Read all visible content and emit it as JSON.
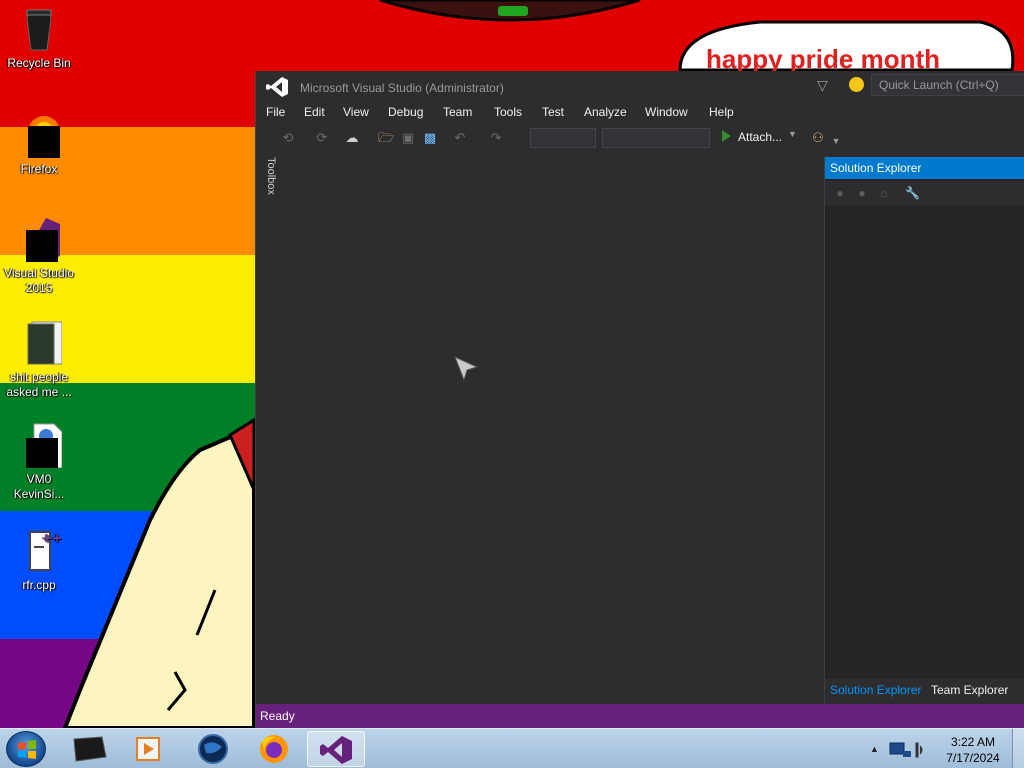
{
  "desktop": {
    "banner_text": "happy pride month",
    "icons": [
      {
        "label": "Recycle Bin"
      },
      {
        "label": "Firefox"
      },
      {
        "label": "Visual Studio 2015"
      },
      {
        "label": "shit people asked me ..."
      },
      {
        "label": "VM0 KevinSi..."
      },
      {
        "label": "rfr.cpp"
      }
    ]
  },
  "vs": {
    "title": "Microsoft Visual Studio (Administrator)",
    "quick_launch_placeholder": "Quick Launch (Ctrl+Q)",
    "menu": [
      "File",
      "Edit",
      "View",
      "Debug",
      "Team",
      "Tools",
      "Test",
      "Analyze",
      "Window",
      "Help"
    ],
    "toolbar": {
      "attach_label": "Attach..."
    },
    "toolbox_label": "Toolbox",
    "solution_explorer": {
      "title": "Solution Explorer",
      "tabs": [
        "Solution Explorer",
        "Team Explorer"
      ]
    },
    "status": "Ready"
  },
  "taskbar": {
    "time": "3:22 AM",
    "date": "7/17/2024"
  },
  "colors": {
    "vs_accent": "#007acc",
    "vs_status_purple": "#68217a",
    "vs_background": "#2d2d30"
  }
}
